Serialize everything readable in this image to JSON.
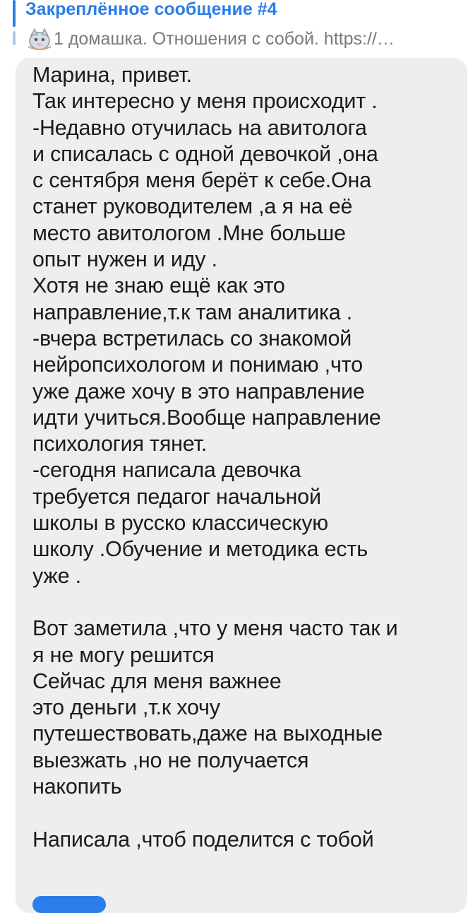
{
  "pinned": {
    "title": "Закреплённое сообщение #4",
    "preview": "1 домашка. Отношения с собой.  https://…",
    "icon": "sticker-emoji-icon",
    "accent": "#2b7de9"
  },
  "message": {
    "text": "Марина, привет.\nТак интересно у меня происходит .\n-Недавно отучилась на авитолога\nи списалась с одной девочкой ,она\nс сентября меня берёт к себе.Она\nстанет руководителем ,а я на её\nместо авитологом .Мне больше\nопыт нужен и иду .\nХотя не знаю ещё как это\nнаправление,т.к там аналитика .\n-вчера встретилась со знакомой\nнейропсихологом и понимаю ,что\nуже даже хочу в это направление\nидти учиться.Вообще направление\nпсихология тянет.\n-сегодня написала девочка\nтребуется педагог начальной\nшколы в русско классическую\nшколу .Обучение и методика есть\nуже .\n\nВот заметила ,что у меня часто так и\nя не могу решится\nСейчас для меня важнее\nэто деньги ,т.к хочу\nпутешествовать,даже на выходные\nвыезжать ,но не получается\nнакопить\n\nНаписала ,чтоб поделится с тобой",
    "bubble_color": "#eeeeee"
  }
}
